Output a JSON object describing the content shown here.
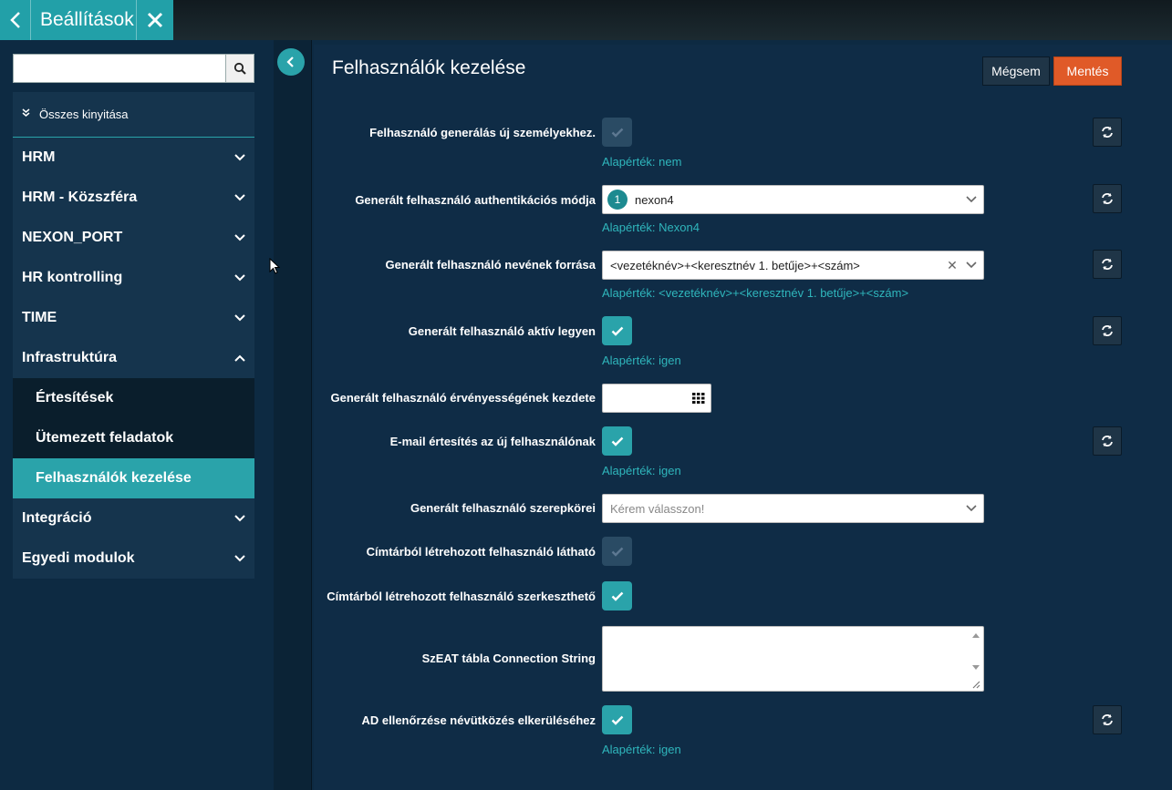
{
  "topbar": {
    "title": "Beállítások"
  },
  "sidebar": {
    "search": {
      "value": "",
      "placeholder": ""
    },
    "expand_all": "Összes kinyitása",
    "items": [
      {
        "label": "HRM",
        "expanded": false
      },
      {
        "label": "HRM - Közszféra",
        "expanded": false
      },
      {
        "label": "NEXON_PORT",
        "expanded": false
      },
      {
        "label": "HR kontrolling",
        "expanded": false
      },
      {
        "label": "TIME",
        "expanded": false
      },
      {
        "label": "Infrastruktúra",
        "expanded": true
      },
      {
        "label": "Integráció",
        "expanded": false
      },
      {
        "label": "Egyedi modulok",
        "expanded": false
      }
    ],
    "subitems": [
      {
        "label": "Értesítések"
      },
      {
        "label": "Ütemezett feladatok"
      },
      {
        "label": "Felhasználók kezelése",
        "active": true
      }
    ]
  },
  "main": {
    "title": "Felhasználók kezelése",
    "cancel_label": "Mégsem",
    "save_label": "Mentés",
    "fields": {
      "gen_new": {
        "label": "Felhasználó generálás új személyekhez.",
        "checked": false,
        "hint": "Alapérték: nem"
      },
      "auth_mode": {
        "label": "Generált felhasználó authentikációs módja",
        "badge": "1",
        "value": "nexon4",
        "hint": "Alapérték: Nexon4"
      },
      "name_source": {
        "label": "Generált felhasználó nevének forrása",
        "value": "<vezetéknév>+<keresztnév 1. betűje>+<szám>",
        "hint": "Alapérték: <vezetéknév>+<keresztnév 1. betűje>+<szám>"
      },
      "active": {
        "label": "Generált felhasználó aktív legyen",
        "checked": true,
        "hint": "Alapérték: igen"
      },
      "validity_start": {
        "label": "Generált felhasználó érvényességének kezdete",
        "value": ""
      },
      "email_notify": {
        "label": "E-mail értesítés az új felhasználónak",
        "checked": true,
        "hint": "Alapérték: igen"
      },
      "roles": {
        "label": "Generált felhasználó szerepkörei",
        "placeholder": "Kérem válasszon!"
      },
      "dir_visible": {
        "label": "Címtárból létrehozott felhasználó látható",
        "checked": false
      },
      "dir_editable": {
        "label": "Címtárból létrehozott felhasználó szerkeszthető",
        "checked": true
      },
      "szeat_conn": {
        "label": "SzEAT tábla Connection String",
        "value": ""
      },
      "ad_check": {
        "label": "AD ellenőrzése névütközés elkerüléséhez",
        "checked": true,
        "hint": "Alapérték: igen"
      }
    }
  },
  "colors": {
    "accent": "#2aa3aa",
    "save": "#e05a28",
    "hint": "#2fb6bc",
    "background": "#0f2c46"
  }
}
